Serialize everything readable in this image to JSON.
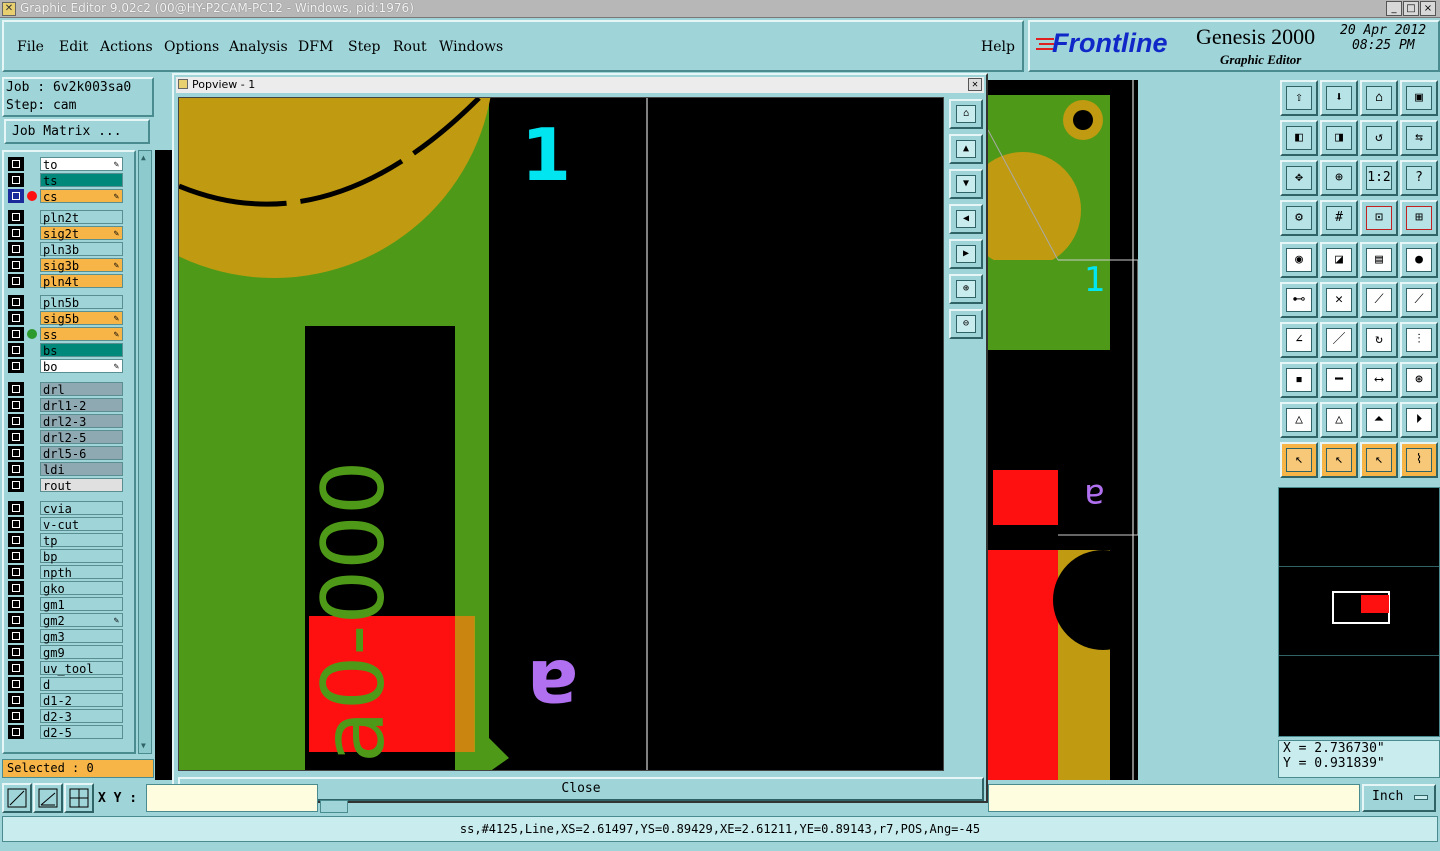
{
  "window": {
    "title": "Graphic Editor 9.02c2 (00@HY-P2CAM-PC12 - Windows, pid:1976)",
    "minimize": "_",
    "maximize": "□",
    "close": "×"
  },
  "menubar": {
    "file": "File",
    "edit": "Edit",
    "actions": "Actions",
    "options": "Options",
    "analysis": "Analysis",
    "dfm": "DFM",
    "step": "Step",
    "rout": "Rout",
    "windows": "Windows",
    "help": "Help"
  },
  "brand": {
    "logo": "Frontline",
    "product": "Genesis 2000",
    "subtitle": "Graphic Editor",
    "date": "20 Apr 2012",
    "time": "08:25 PM"
  },
  "job": {
    "job_label": "Job : 6v2k003sa0",
    "step_label": "Step: cam",
    "matrix_button": "Job Matrix ...",
    "selected": "Selected : 0"
  },
  "layers": [
    {
      "name": "to",
      "color": "#ffffff",
      "pen": true
    },
    {
      "name": "ts",
      "color": "#00897a"
    },
    {
      "name": "cs",
      "color": "#f7b548",
      "pen": true,
      "active": true
    },
    {
      "name": "pln2t",
      "color": "#9fd4d8"
    },
    {
      "name": "sig2t",
      "color": "#f7b548",
      "pen": true
    },
    {
      "name": "pln3b",
      "color": "#9fd4d8"
    },
    {
      "name": "sig3b",
      "color": "#f7b548",
      "pen": true
    },
    {
      "name": "pln4t",
      "color": "#f7b548"
    },
    {
      "name": "pln5b",
      "color": "#9fd4d8"
    },
    {
      "name": "sig5b",
      "color": "#f7b548",
      "pen": true
    },
    {
      "name": "ss",
      "color": "#f7b548",
      "pen": true,
      "green": true
    },
    {
      "name": "bs",
      "color": "#00897a"
    },
    {
      "name": "bo",
      "color": "#ffffff",
      "pen": true
    },
    {
      "name": "drl",
      "color": "#8fa9b3"
    },
    {
      "name": "drl1-2",
      "color": "#8fa9b3"
    },
    {
      "name": "drl2-3",
      "color": "#8fa9b3"
    },
    {
      "name": "drl2-5",
      "color": "#8fa9b3"
    },
    {
      "name": "drl5-6",
      "color": "#8fa9b3"
    },
    {
      "name": "ldi",
      "color": "#8fa9b3"
    },
    {
      "name": "rout",
      "color": "#e0e0e0"
    },
    {
      "name": "cvia",
      "color": "#9fd4d8"
    },
    {
      "name": "v-cut",
      "color": "#9fd4d8"
    },
    {
      "name": "tp",
      "color": "#9fd4d8"
    },
    {
      "name": "bp",
      "color": "#9fd4d8"
    },
    {
      "name": "npth",
      "color": "#9fd4d8"
    },
    {
      "name": "gko",
      "color": "#9fd4d8"
    },
    {
      "name": "gm1",
      "color": "#9fd4d8"
    },
    {
      "name": "gm2",
      "color": "#9fd4d8",
      "pen": true
    },
    {
      "name": "gm3",
      "color": "#9fd4d8"
    },
    {
      "name": "gm9",
      "color": "#9fd4d8"
    },
    {
      "name": "uv_tool",
      "color": "#9fd4d8"
    },
    {
      "name": "d",
      "color": "#9fd4d8"
    },
    {
      "name": "d1-2",
      "color": "#9fd4d8"
    },
    {
      "name": "d2-3",
      "color": "#9fd4d8"
    },
    {
      "name": "d2-5",
      "color": "#9fd4d8"
    }
  ],
  "popup": {
    "title": "Popview - 1",
    "close_button": "Close",
    "label_1": "1",
    "label_a": "a",
    "board_text": "a0-000"
  },
  "main_canvas": {
    "label_1": "1",
    "label_a": "a"
  },
  "coords": {
    "x": "X = 2.736730\"",
    "y": "Y = 0.931839\""
  },
  "bottom": {
    "xy_label": "X Y :",
    "units": "Inch",
    "status": "ss,#4125,Line,XS=2.61497,YS=0.89429,XE=2.61211,YE=0.89143,r7,POS,Ang=-45"
  },
  "colors": {
    "panel": "#9fd4d8",
    "copper": "#c09a10",
    "green": "#4e9a18",
    "red": "#ff1010",
    "cyan": "#00e5f0",
    "purple": "#b070f0"
  }
}
